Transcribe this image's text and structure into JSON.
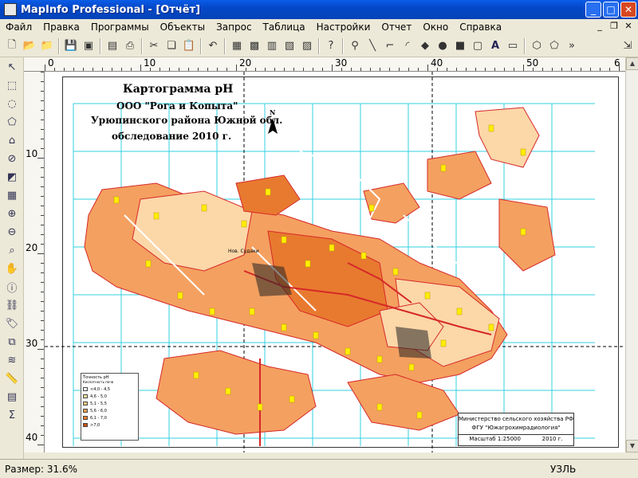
{
  "window": {
    "title": "MapInfo Professional - [Отчёт]",
    "minimize": "_",
    "maximize": "□",
    "close": "✕"
  },
  "menu": {
    "items": [
      "Файл",
      "Правка",
      "Программы",
      "Объекты",
      "Запрос",
      "Таблица",
      "Настройки",
      "Отчет",
      "Окно",
      "Справка"
    ]
  },
  "rulers": {
    "horizontal_labels": [
      "0",
      "10",
      "20",
      "30",
      "40",
      "50",
      "6"
    ],
    "vertical_labels": [
      "10",
      "20",
      "30",
      "40"
    ]
  },
  "map": {
    "title_line1": "Картограмма pH",
    "title_line2": "ООО \"Рога и Копыта\"",
    "title_line3": "Урюпинского района Южной обл.",
    "title_line4": "обследование 2010 г.",
    "north_label": "N",
    "legend_title": "Точность pH",
    "legend_subtitle": "Кислотность почв",
    "legend_items": [
      "<4,0 - 4,5",
      "4,6 - 5,0",
      "5,1 - 5,5",
      "5,6 - 6,0",
      "6,1 - 7,0",
      ">7,0"
    ],
    "legend_colors": [
      "#ffffff",
      "#ffe8a0",
      "#ffc880",
      "#f8a050",
      "#f08030",
      "#d05010"
    ],
    "info_line1": "Министерство сельского хозяйства РФ",
    "info_line2": "ФГУ \"Южагрохимрадиология\"",
    "info_scale": "Масштаб 1:25000",
    "info_year": "2010 г.",
    "village_label": "Нов. Судаки"
  },
  "status": {
    "size": "Размер: 31.6%",
    "node": "УЗЛЬ"
  },
  "colors": {
    "field_orange": "#f4a060",
    "field_light": "#fcd7a8",
    "field_dark": "#e87a30",
    "boundary": "#d62828",
    "grid": "#33d0e0",
    "marker": "#ffee00"
  }
}
